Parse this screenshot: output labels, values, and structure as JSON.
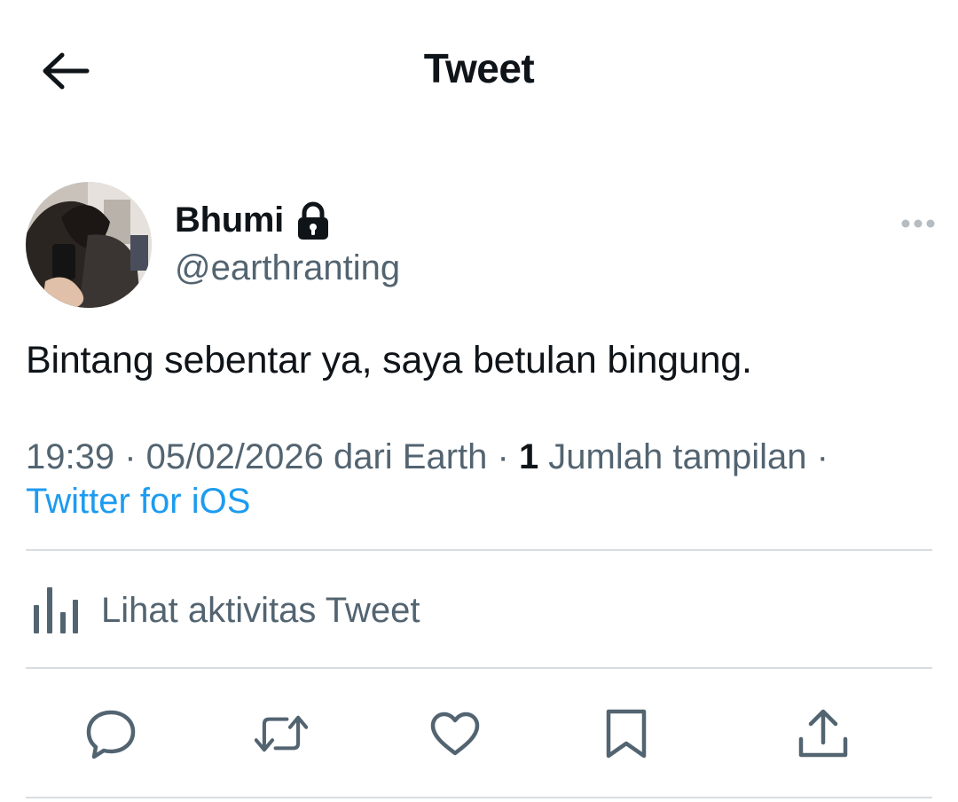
{
  "header": {
    "title": "Tweet",
    "back_icon": "arrow-left-icon"
  },
  "author": {
    "display_name": "Bhumi",
    "handle": "@earthranting",
    "protected_icon": "lock-icon",
    "more_icon": "more-horizontal-icon"
  },
  "tweet": {
    "text": "Bintang sebentar ya, saya betulan bingung."
  },
  "meta": {
    "time": "19:39",
    "separator": " · ",
    "date": "05/02/2026",
    "location": " dari Earth",
    "views_count": "1",
    "views_label": " Jumlah tampilan",
    "source": "Twitter for iOS"
  },
  "activity": {
    "label": "Lihat aktivitas Tweet",
    "icon": "bar-chart-icon"
  },
  "actions": {
    "reply_icon": "reply-icon",
    "retweet_icon": "retweet-icon",
    "like_icon": "heart-icon",
    "bookmark_icon": "bookmark-icon",
    "share_icon": "share-icon"
  },
  "colors": {
    "text_primary": "#0f1419",
    "text_secondary": "#536471",
    "link": "#1d9bf0",
    "divider": "#d9dde1"
  }
}
